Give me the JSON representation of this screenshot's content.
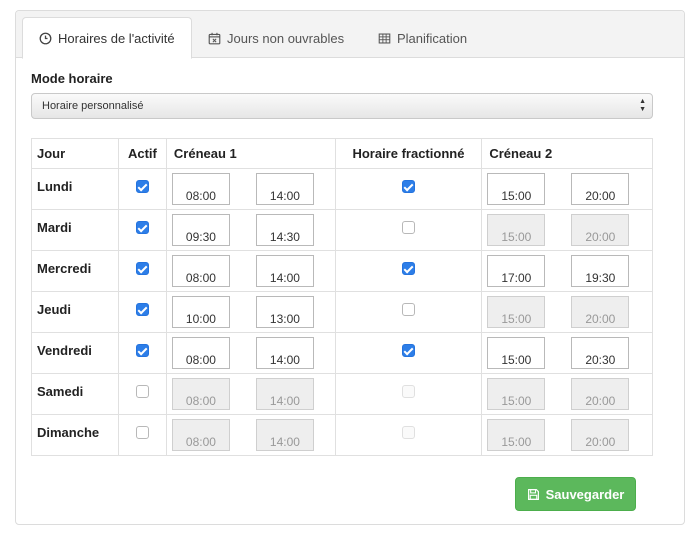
{
  "tabs": [
    {
      "label": "Horaires de l'activité",
      "icon": "clock-icon",
      "active": true
    },
    {
      "label": "Jours non ouvrables",
      "icon": "calendar-x-icon",
      "active": false
    },
    {
      "label": "Planification",
      "icon": "table-icon",
      "active": false
    }
  ],
  "mode": {
    "label": "Mode horaire",
    "selected": "Horaire personnalisé"
  },
  "table": {
    "headers": {
      "jour": "Jour",
      "actif": "Actif",
      "creneau1": "Créneau 1",
      "fractionne": "Horaire fractionné",
      "creneau2": "Créneau 2"
    },
    "rows": [
      {
        "day": "Lundi",
        "active": true,
        "s1_start": "08:00",
        "s1_end": "14:00",
        "split": true,
        "s2_start": "15:00",
        "s2_end": "20:00"
      },
      {
        "day": "Mardi",
        "active": true,
        "s1_start": "09:30",
        "s1_end": "14:30",
        "split": false,
        "s2_start": "15:00",
        "s2_end": "20:00"
      },
      {
        "day": "Mercredi",
        "active": true,
        "s1_start": "08:00",
        "s1_end": "14:00",
        "split": true,
        "s2_start": "17:00",
        "s2_end": "19:30"
      },
      {
        "day": "Jeudi",
        "active": true,
        "s1_start": "10:00",
        "s1_end": "13:00",
        "split": false,
        "s2_start": "15:00",
        "s2_end": "20:00"
      },
      {
        "day": "Vendredi",
        "active": true,
        "s1_start": "08:00",
        "s1_end": "14:00",
        "split": true,
        "s2_start": "15:00",
        "s2_end": "20:30"
      },
      {
        "day": "Samedi",
        "active": false,
        "s1_start": "08:00",
        "s1_end": "14:00",
        "split": false,
        "s2_start": "15:00",
        "s2_end": "20:00"
      },
      {
        "day": "Dimanche",
        "active": false,
        "s1_start": "08:00",
        "s1_end": "14:00",
        "split": false,
        "s2_start": "15:00",
        "s2_end": "20:00"
      }
    ]
  },
  "save_button": {
    "label": "Sauvegarder",
    "icon": "floppy-disk-icon"
  },
  "colors": {
    "accent": "#2d7ee8",
    "success": "#5cb85c"
  }
}
